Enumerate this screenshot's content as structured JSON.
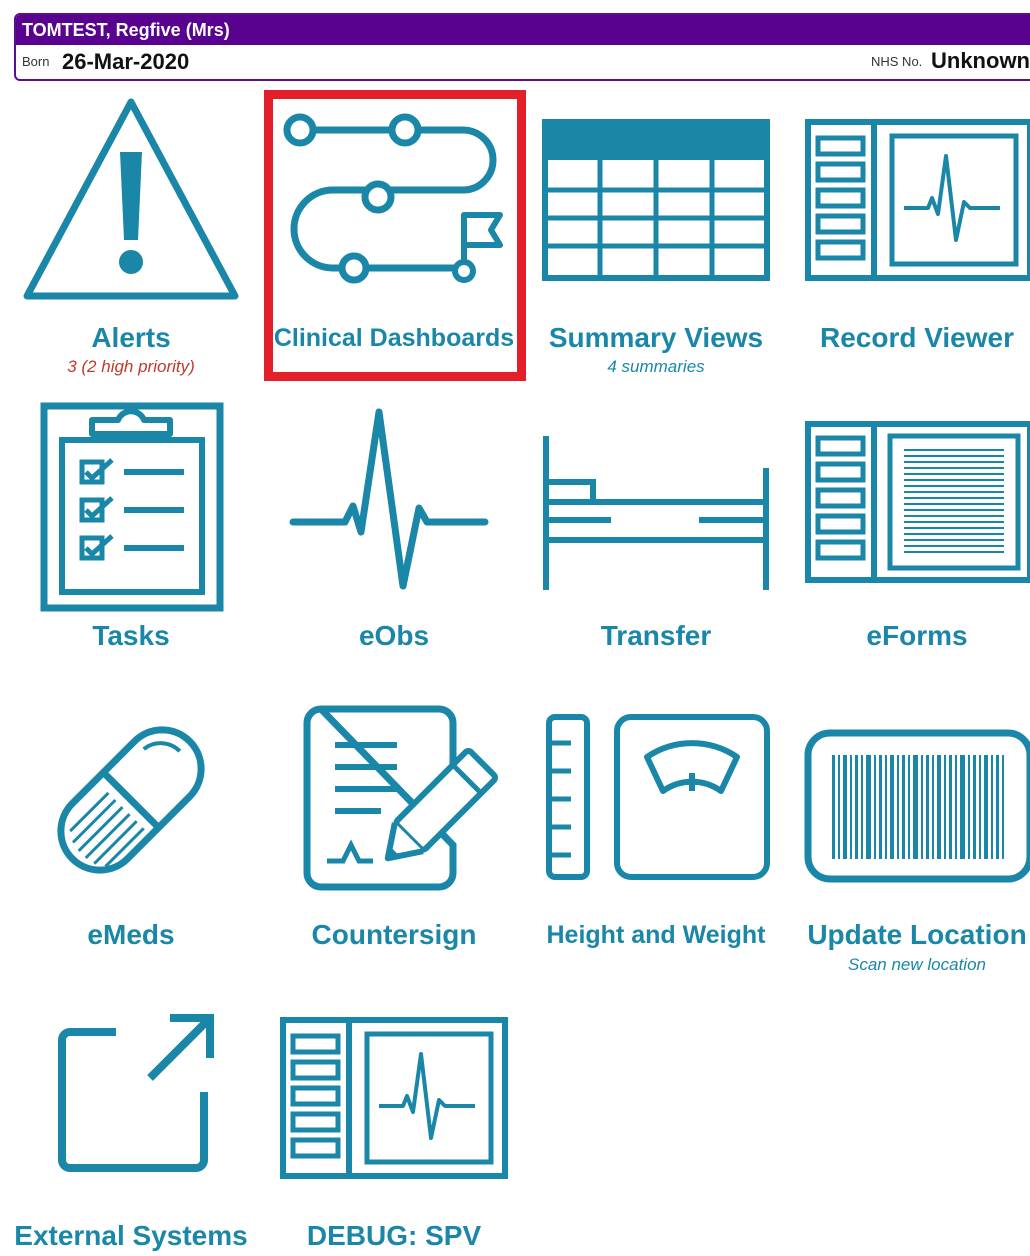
{
  "patient": {
    "name": "TOMTEST, Regfive (Mrs)",
    "born_label": "Born",
    "born_value": "26-Mar-2020",
    "nhs_label": "NHS No.",
    "nhs_value": "Unknown"
  },
  "tiles": [
    {
      "label": "Alerts",
      "sub": "3 (2 high priority)",
      "icon": "warning-triangle-icon"
    },
    {
      "label": "Clinical Dashboards",
      "sub": "",
      "icon": "pathway-flag-icon"
    },
    {
      "label": "Summary Views",
      "sub": "4 summaries",
      "icon": "table-grid-icon"
    },
    {
      "label": "Record Viewer",
      "sub": "",
      "icon": "record-monitor-icon"
    },
    {
      "label": "Tasks",
      "sub": "",
      "icon": "clipboard-checklist-icon"
    },
    {
      "label": "eObs",
      "sub": "",
      "icon": "heartbeat-icon"
    },
    {
      "label": "Transfer",
      "sub": "",
      "icon": "bed-icon"
    },
    {
      "label": "eForms",
      "sub": "",
      "icon": "form-document-icon"
    },
    {
      "label": "eMeds",
      "sub": "",
      "icon": "pill-capsule-icon"
    },
    {
      "label": "Countersign",
      "sub": "",
      "icon": "document-pen-icon"
    },
    {
      "label": "Height and Weight",
      "sub": "",
      "icon": "scale-ruler-icon"
    },
    {
      "label": "Update Location",
      "sub": "Scan new location",
      "icon": "barcode-icon"
    },
    {
      "label": "External Systems",
      "sub": "",
      "icon": "external-link-icon"
    },
    {
      "label": "DEBUG: SPV",
      "sub": "",
      "icon": "record-monitor-icon"
    }
  ],
  "colors": {
    "icon": "#1a87a8",
    "banner": "#5a0290",
    "alert_text": "#c0392b",
    "highlight": "#e3202a"
  }
}
